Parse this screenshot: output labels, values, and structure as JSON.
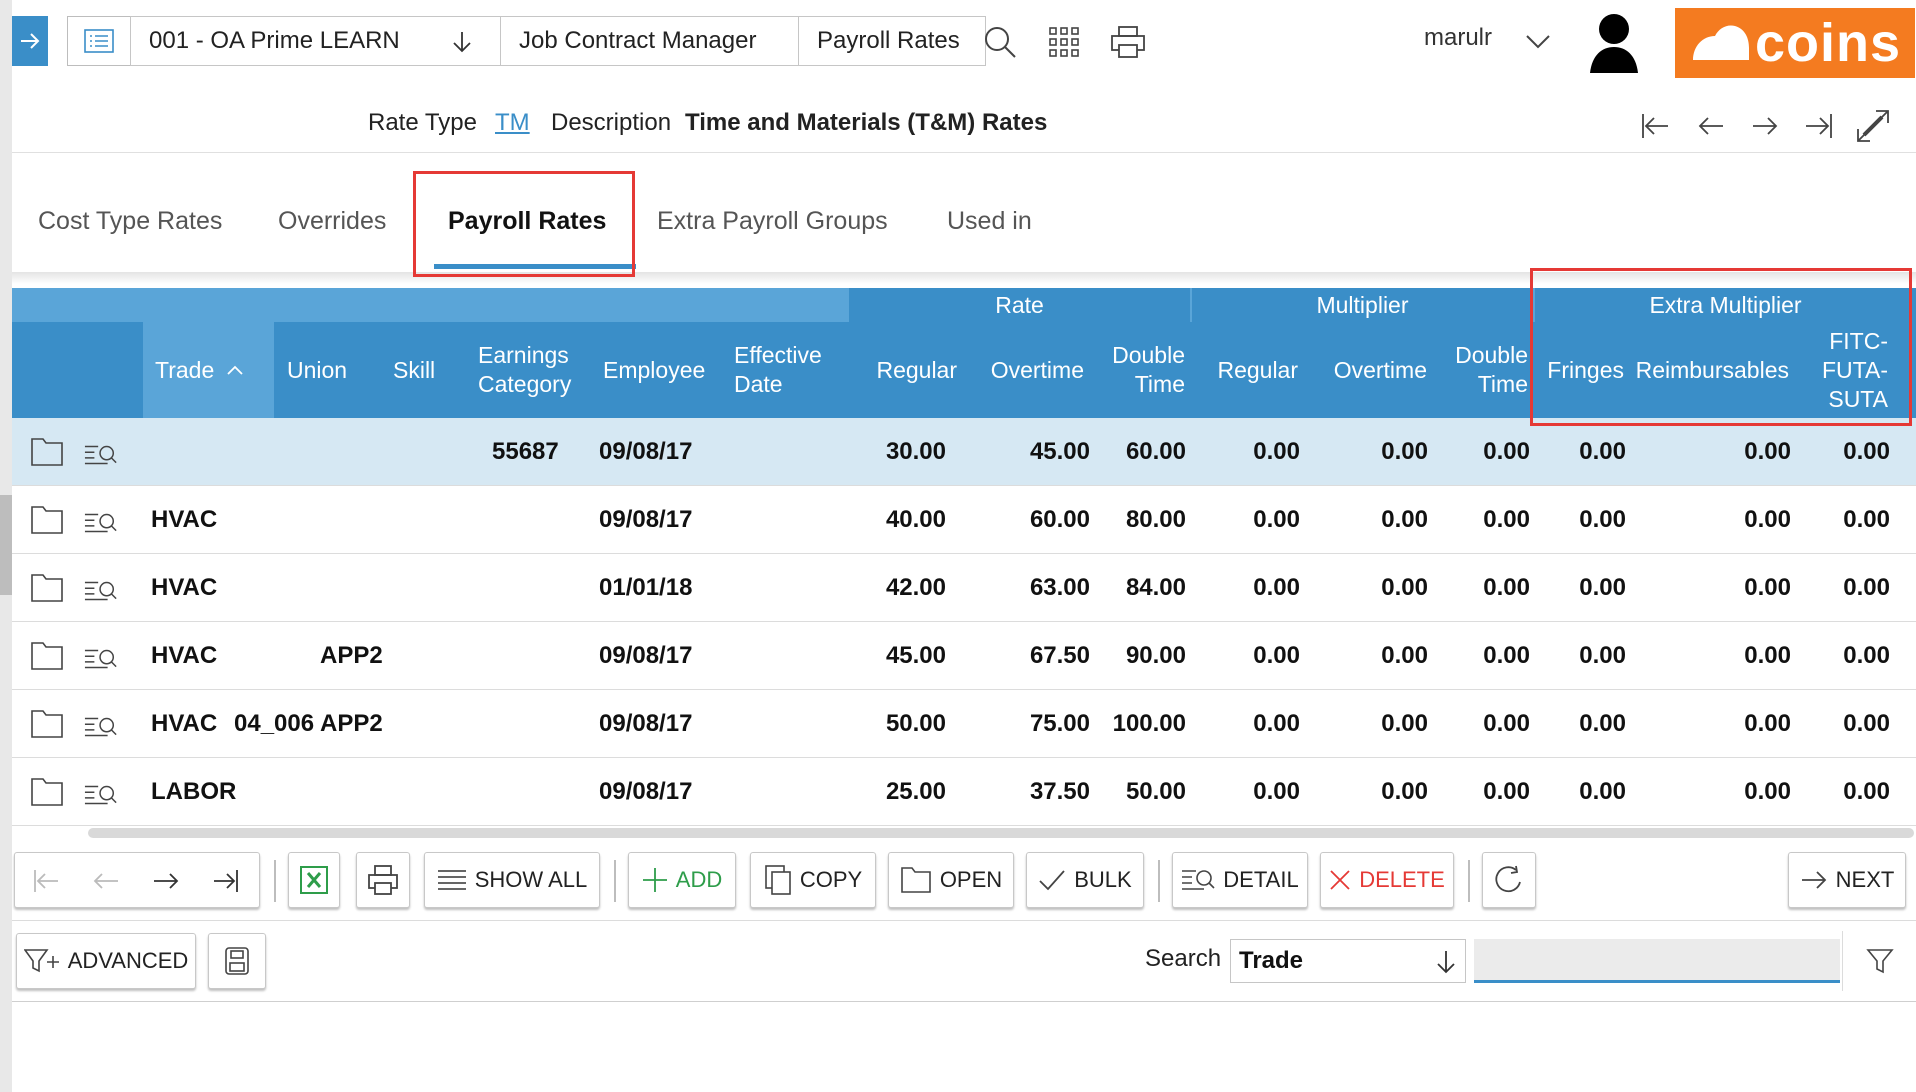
{
  "breadcrumb": {
    "items": [
      "001 - OA Prime LEARN",
      "Job Contract Manager",
      "Payroll Rates"
    ]
  },
  "header": {
    "username": "marulr",
    "logo_text": "coins"
  },
  "record": {
    "rate_type_label": "Rate Type",
    "rate_type_value": "TM",
    "description_label": "Description",
    "description_value": "Time and Materials (T&M) Rates"
  },
  "tabs": [
    {
      "label": "Cost Type Rates"
    },
    {
      "label": "Overrides"
    },
    {
      "label": "Payroll Rates"
    },
    {
      "label": "Extra Payroll Groups"
    },
    {
      "label": "Used in"
    }
  ],
  "grid": {
    "groups": {
      "rate": "Rate",
      "multiplier": "Multiplier",
      "extra_multiplier": "Extra Multiplier"
    },
    "columns": {
      "trade": "Trade",
      "union": "Union",
      "skill": "Skill",
      "earnings_1": "Earnings",
      "earnings_2": "Category",
      "employee": "Employee",
      "eff_1": "Effective",
      "eff_2": "Date",
      "rate_regular": "Regular",
      "rate_overtime": "Overtime",
      "rate_dt_1": "Double",
      "rate_dt_2": "Time",
      "mult_regular": "Regular",
      "mult_overtime": "Overtime",
      "mult_dt_1": "Double",
      "mult_dt_2": "Time",
      "fringes": "Fringes",
      "reimbursables": "Reimbursables",
      "fitc_1": "FITC-",
      "fitc_2": "FUTA-",
      "fitc_3": "SUTA"
    },
    "rows": [
      {
        "trade": "",
        "union": "",
        "skill": "",
        "employee": "55687",
        "date": "09/08/17",
        "rate_regular": "30.00",
        "rate_overtime": "45.00",
        "rate_dt": "60.00",
        "mult_regular": "0.00",
        "mult_overtime": "0.00",
        "mult_dt": "0.00",
        "fringes": "0.00",
        "reimbursables": "0.00",
        "fitc": "0.00"
      },
      {
        "trade": "HVAC",
        "union": "",
        "skill": "",
        "employee": "",
        "date": "09/08/17",
        "rate_regular": "40.00",
        "rate_overtime": "60.00",
        "rate_dt": "80.00",
        "mult_regular": "0.00",
        "mult_overtime": "0.00",
        "mult_dt": "0.00",
        "fringes": "0.00",
        "reimbursables": "0.00",
        "fitc": "0.00"
      },
      {
        "trade": "HVAC",
        "union": "",
        "skill": "",
        "employee": "",
        "date": "01/01/18",
        "rate_regular": "42.00",
        "rate_overtime": "63.00",
        "rate_dt": "84.00",
        "mult_regular": "0.00",
        "mult_overtime": "0.00",
        "mult_dt": "0.00",
        "fringes": "0.00",
        "reimbursables": "0.00",
        "fitc": "0.00"
      },
      {
        "trade": "HVAC",
        "union": "",
        "skill": "APP2",
        "employee": "",
        "date": "09/08/17",
        "rate_regular": "45.00",
        "rate_overtime": "67.50",
        "rate_dt": "90.00",
        "mult_regular": "0.00",
        "mult_overtime": "0.00",
        "mult_dt": "0.00",
        "fringes": "0.00",
        "reimbursables": "0.00",
        "fitc": "0.00"
      },
      {
        "trade": "HVAC",
        "union": "04_006",
        "skill": "APP2",
        "employee": "",
        "date": "09/08/17",
        "rate_regular": "50.00",
        "rate_overtime": "75.00",
        "rate_dt": "100.00",
        "mult_regular": "0.00",
        "mult_overtime": "0.00",
        "mult_dt": "0.00",
        "fringes": "0.00",
        "reimbursables": "0.00",
        "fitc": "0.00"
      },
      {
        "trade": "LABOR",
        "union": "",
        "skill": "",
        "employee": "",
        "date": "09/08/17",
        "rate_regular": "25.00",
        "rate_overtime": "37.50",
        "rate_dt": "50.00",
        "mult_regular": "0.00",
        "mult_overtime": "0.00",
        "mult_dt": "0.00",
        "fringes": "0.00",
        "reimbursables": "0.00",
        "fitc": "0.00"
      }
    ]
  },
  "toolbar": {
    "show_all": "SHOW ALL",
    "add": "ADD",
    "copy": "COPY",
    "open": "OPEN",
    "bulk": "BULK",
    "detail": "DETAIL",
    "delete": "DELETE",
    "next": "NEXT"
  },
  "search": {
    "advanced": "ADVANCED",
    "label": "Search",
    "field": "Trade",
    "value": ""
  },
  "colors": {
    "accent": "#3a8ec8",
    "accent_light": "#5aa5d8",
    "selected_row": "#d6e8f3",
    "brand": "#f47b20",
    "highlight": "#e53935",
    "add": "#2e9d4a"
  }
}
